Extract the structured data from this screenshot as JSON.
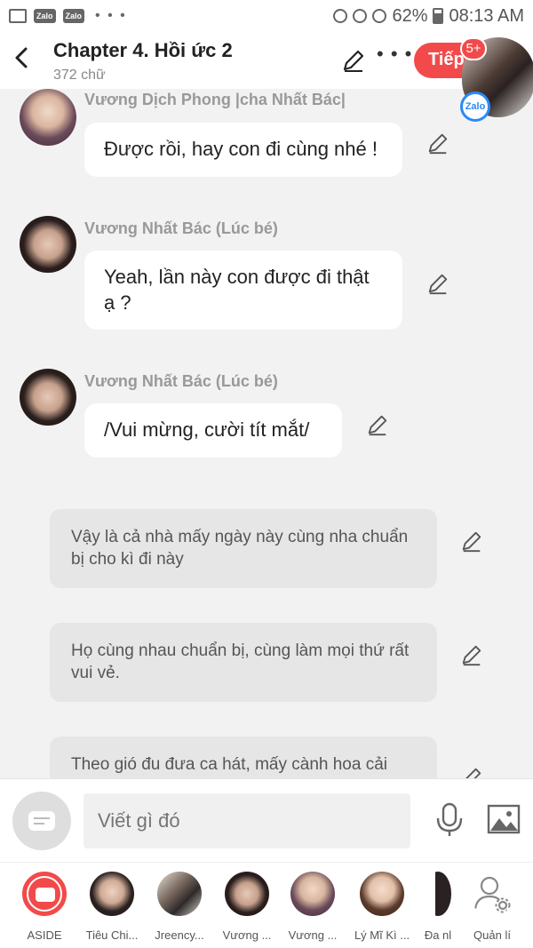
{
  "status_bar": {
    "zalo_1": "Zalo",
    "zalo_2": "Zalo",
    "dots": "• • •",
    "battery": "62%",
    "time": "08:13 AM"
  },
  "header": {
    "title": "Chapter 4. Hồi ức 2",
    "subtitle": "372 chữ",
    "next_label": "Tiếp",
    "badge": "5+",
    "zalo_chip": "Zalo"
  },
  "messages": [
    {
      "sender": "Vương Dịch Phong |cha Nhất Bác|",
      "text": "Được rồi, hay con đi cùng nhé !"
    },
    {
      "sender": "Vương Nhất Bác (Lúc bé)",
      "text": "Yeah, lần này con được đi thật ạ ?"
    },
    {
      "sender": "Vương Nhất Bác (Lúc bé)",
      "text": "/Vui mừng, cười tít mắt/"
    }
  ],
  "narrations": [
    "Vậy là cả nhà mấy ngày này cùng nha chuẩn bị cho kì đi này",
    "Họ cùng nhau chuẩn bị, cùng làm mọi thứ rất vui vẻ.",
    "Theo gió đu đưa ca hát, mấy cành hoa cải"
  ],
  "composer": {
    "placeholder": "Viết gì đó"
  },
  "characters": [
    {
      "label": "ASIDE"
    },
    {
      "label": "Tiêu Chi..."
    },
    {
      "label": "Jreency..."
    },
    {
      "label": "Vương ..."
    },
    {
      "label": "Vương ..."
    },
    {
      "label": "Lý Mĩ Kì ..."
    },
    {
      "label": "Đa nl"
    },
    {
      "label": "Quản lí"
    }
  ],
  "colors": {
    "accent": "#f24a4a",
    "zalo_blue": "#2a8af6",
    "background": "#f2f2f2"
  }
}
